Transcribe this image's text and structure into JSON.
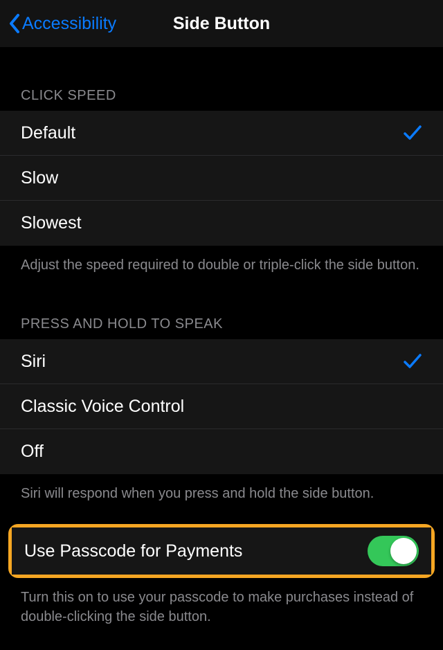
{
  "header": {
    "back_label": "Accessibility",
    "title": "Side Button"
  },
  "click_speed": {
    "header": "CLICK SPEED",
    "options": [
      {
        "label": "Default",
        "selected": true
      },
      {
        "label": "Slow",
        "selected": false
      },
      {
        "label": "Slowest",
        "selected": false
      }
    ],
    "footer": "Adjust the speed required to double or triple-click the side button."
  },
  "press_hold": {
    "header": "PRESS AND HOLD TO SPEAK",
    "options": [
      {
        "label": "Siri",
        "selected": true
      },
      {
        "label": "Classic Voice Control",
        "selected": false
      },
      {
        "label": "Off",
        "selected": false
      }
    ],
    "footer": "Siri will respond when you press and hold the side button."
  },
  "passcode": {
    "label": "Use Passcode for Payments",
    "enabled": true,
    "footer": "Turn this on to use your passcode to make purchases instead of double-clicking the side button."
  }
}
